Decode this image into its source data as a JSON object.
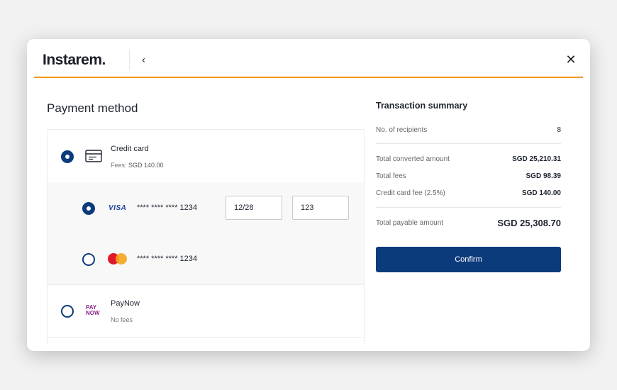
{
  "header": {
    "logo": "Instarem.",
    "back_icon": "chevron-left-icon",
    "close_icon": "close-icon"
  },
  "payment": {
    "title": "Payment method",
    "credit_card": {
      "label": "Credit card",
      "fees_prefix": "Fees:",
      "fees_value": "SGD 140.00",
      "selected": true,
      "icon": "credit-card-icon"
    },
    "saved_cards": [
      {
        "brand": "VISA",
        "masked_number": "**** **** **** 1234",
        "expiry": "12/28",
        "cvv": "123",
        "selected": true
      },
      {
        "brand": "MasterCard",
        "masked_number": "**** **** **** 1234",
        "selected": false
      }
    ],
    "paynow": {
      "logo_line1": "PAY",
      "logo_line2": "NOW",
      "label": "PayNow",
      "fees": "No fees",
      "selected": false
    }
  },
  "summary": {
    "title": "Transaction summary",
    "recipients_label": "No. of recipients",
    "recipients_value": "8",
    "converted_label": "Total converted amount",
    "converted_value": "SGD 25,210.31",
    "fees_label": "Total fees",
    "fees_value": "SGD 98.39",
    "cc_fee_label": "Credit card fee (2.5%)",
    "cc_fee_value": "SGD 140.00",
    "payable_label": "Total payable amount",
    "payable_value": "SGD 25,308.70",
    "confirm_label": "Confirm"
  },
  "colors": {
    "accent": "#ef9a1c",
    "primary": "#0b3b7b",
    "background": "#f2f2f2"
  }
}
